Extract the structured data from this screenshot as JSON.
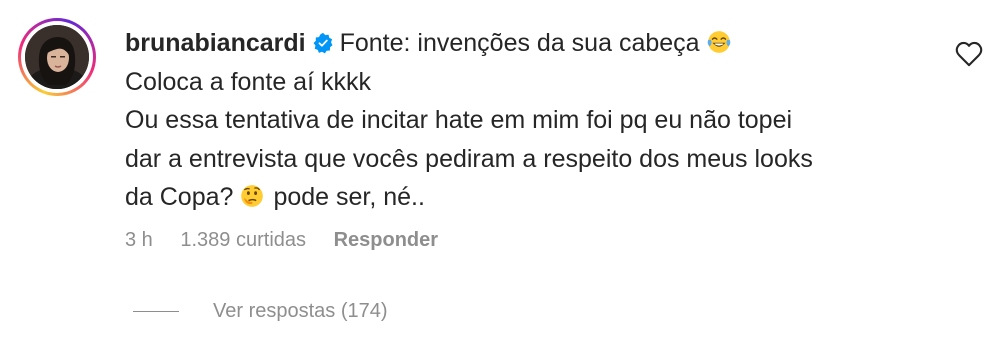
{
  "comment": {
    "username": "brunabiancardi",
    "verified_icon": "verified-badge-icon",
    "line1": "Fonte: invenções da sua cabeça",
    "line1_emoji": "face-with-tears-of-joy-emoji",
    "line2": "Coloca a fonte aí kkkk",
    "line3": "Ou essa tentativa de incitar hate em mim foi pq eu não topei",
    "line4": "dar a entrevista que vocês pediram a respeito dos meus looks",
    "line5_a": "da Copa?",
    "line5_emoji": "thinking-face-emoji",
    "line5_b": "pode ser, né..",
    "time": "3 h",
    "likes": "1.389 curtidas",
    "reply_label": "Responder",
    "view_replies": "Ver respostas (174)",
    "like_icon": "heart-outline-icon"
  },
  "colors": {
    "text": "#262626",
    "secondary": "#8e8e8e",
    "verified": "#0095f6"
  }
}
